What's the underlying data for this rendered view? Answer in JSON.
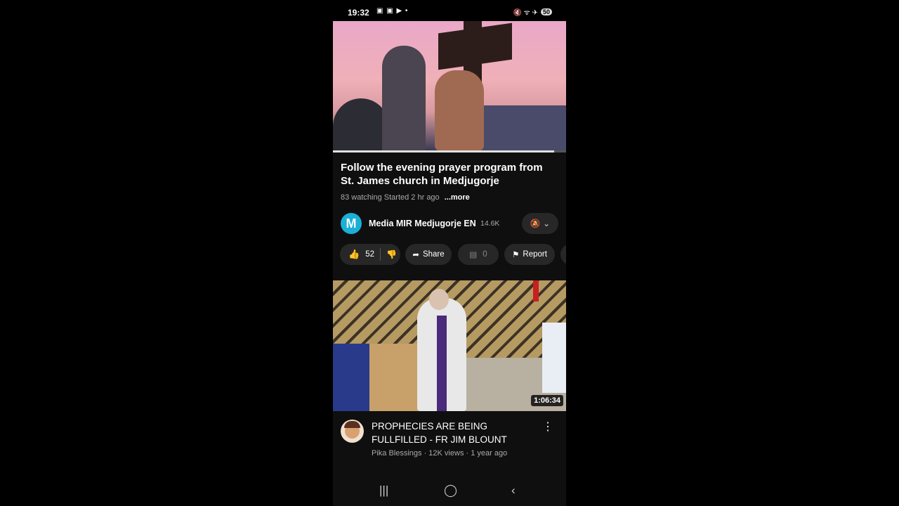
{
  "status_bar": {
    "time": "19:32",
    "left_icons": "▣ ▣ ▶ •",
    "right_icons": "🔇 ᯤ ✈",
    "battery": "50"
  },
  "current_video": {
    "title": "Follow the evening prayer program from St. James church in Medjugorje",
    "watching": "83 watching",
    "started": "Started 2 hr ago",
    "more_label": "...more",
    "progress": 0.95
  },
  "channel": {
    "avatar_letter": "M",
    "name": "Media MIR Medjugorje EN",
    "subscribers": "14.6K",
    "bell_icon": "bell-off-icon",
    "chevron_icon": "chevron-down-icon"
  },
  "actions": {
    "like_count": "52",
    "share_label": "Share",
    "comment_count": "0",
    "report_label": "Report"
  },
  "next_video": {
    "duration": "1:06:34",
    "title": "PROPHECIES ARE BEING FULLFILLED - FR JIM BLOUNT",
    "meta": "Pika Blessings · 12K views · 1 year ago"
  },
  "nav_bar": {
    "recents": "|||",
    "home": "◯",
    "back": "‹"
  }
}
